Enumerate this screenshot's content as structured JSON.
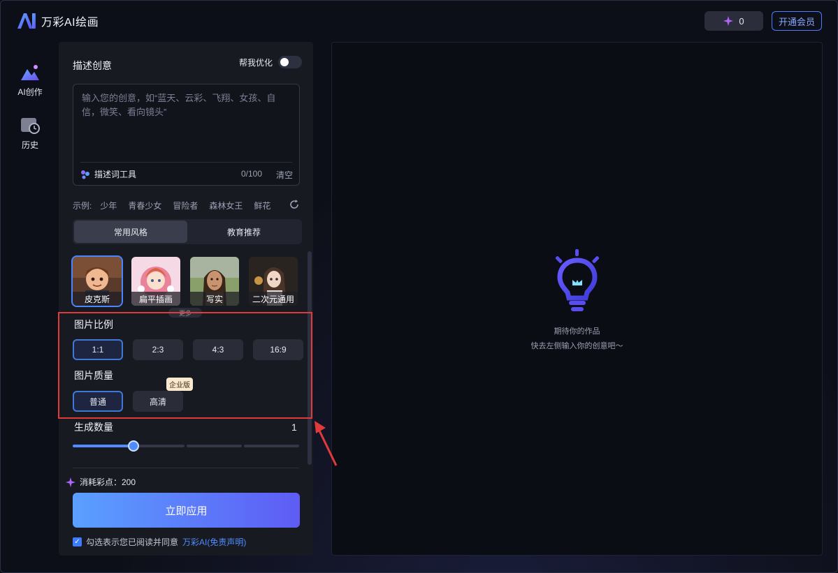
{
  "app": {
    "title": "万彩AI绘画"
  },
  "header": {
    "points_value": "0",
    "member_label": "开通会员"
  },
  "nav": [
    {
      "label": "AI创作",
      "icon": "image-create-icon"
    },
    {
      "label": "历史",
      "icon": "history-icon"
    }
  ],
  "describe": {
    "title": "描述创意",
    "optimize_label": "帮我优化",
    "placeholder": "输入您的创意，如“蓝天、云彩、飞翔、女孩、自信，微笑、看向镜头”",
    "tool_label": "描述词工具",
    "count": "0/100",
    "clear_label": "清空"
  },
  "examples": {
    "label": "示例:",
    "items": [
      "少年",
      "青春少女",
      "冒险者",
      "森林女王",
      "鲜花"
    ]
  },
  "style_tabs": [
    "常用风格",
    "教育推荐"
  ],
  "styles": [
    {
      "label": "皮克斯",
      "selected": true
    },
    {
      "label": "扁平插画",
      "selected": false
    },
    {
      "label": "写实",
      "selected": false
    },
    {
      "label": "二次元通用",
      "selected": false
    }
  ],
  "more_label": "更多",
  "ratio": {
    "title": "图片比例",
    "options": [
      "1:1",
      "2:3",
      "4:3",
      "16:9"
    ],
    "selected": "1:1"
  },
  "quality": {
    "title": "图片质量",
    "options": [
      "普通",
      "高清"
    ],
    "selected": "普通",
    "badge": "企业版"
  },
  "count": {
    "title": "生成数量",
    "value": "1",
    "slider_fraction": 0.27
  },
  "cost": {
    "label": "消耗彩点：200"
  },
  "apply_label": "立即应用",
  "agree": {
    "text": "勾选表示您已阅读并同意",
    "link": "万彩AI(免责声明)",
    "checked": true
  },
  "empty_state": {
    "line1": "期待你的作品",
    "line2": "快去左侧输入你的创意吧～"
  },
  "colors": {
    "accent": "#4f8cff",
    "highlight": "#e03a3a",
    "badge_bg": "#fbe8cf"
  }
}
